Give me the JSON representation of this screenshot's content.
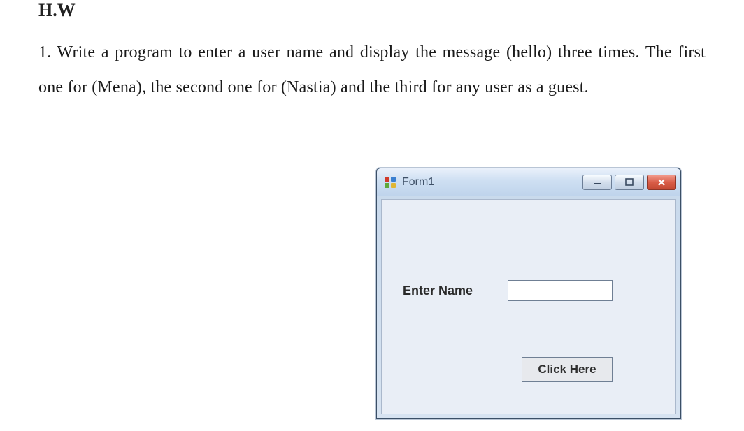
{
  "heading": "H.W",
  "problem_text": "1. Write a program to enter a user name and display the message (hello) three times. The first one for (Mena), the second one for (Nastia) and the third for any user as a guest.",
  "window": {
    "title": "Form1",
    "label": "Enter Name",
    "input_value": "",
    "button_label": "Click Here"
  }
}
